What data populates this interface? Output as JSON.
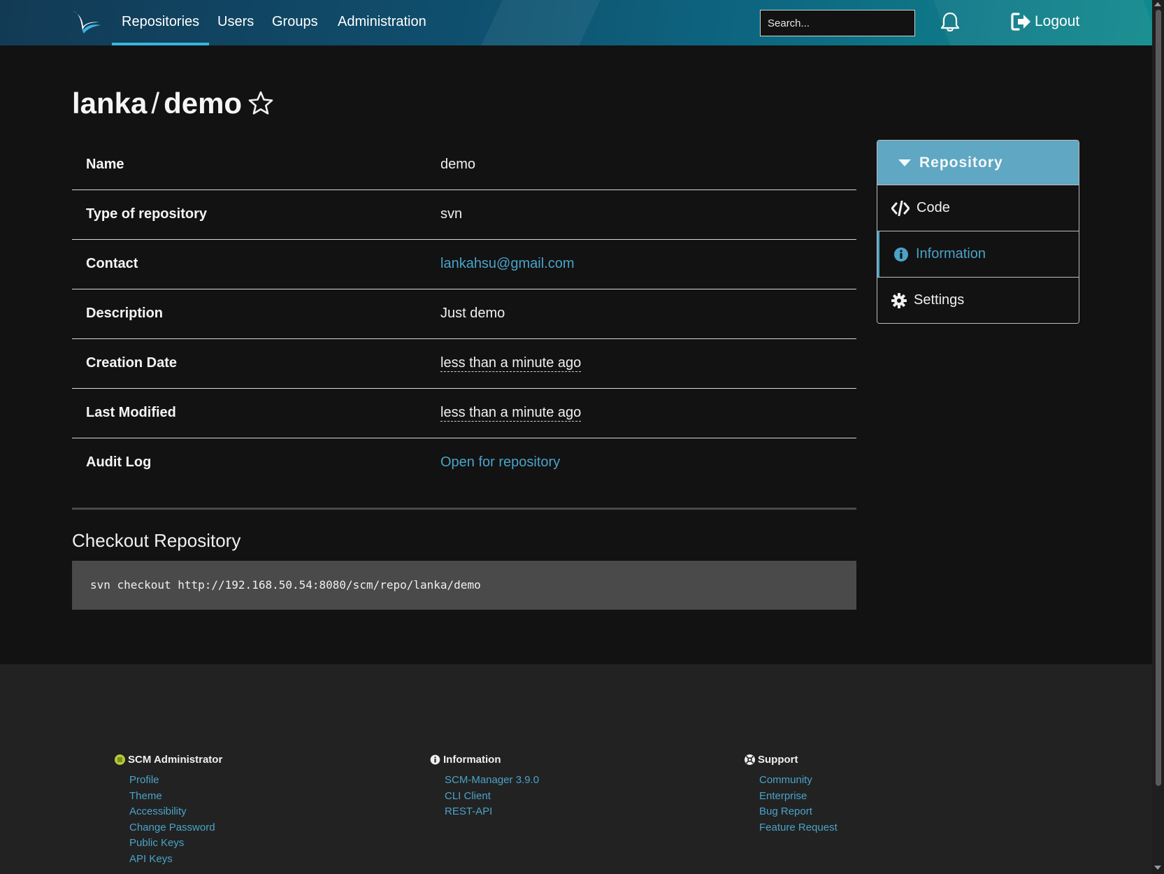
{
  "nav": {
    "items": [
      {
        "label": "Repositories"
      },
      {
        "label": "Users"
      },
      {
        "label": "Groups"
      },
      {
        "label": "Administration"
      }
    ],
    "active_index": 0,
    "search_placeholder": "Search...",
    "logout_label": "Logout"
  },
  "repo": {
    "namespace": "lanka",
    "separator": "/",
    "name": "demo"
  },
  "info": {
    "rows": [
      {
        "label": "Name",
        "value": "demo"
      },
      {
        "label": "Type of repository",
        "value": "svn"
      },
      {
        "label": "Contact",
        "value": "lankahsu@gmail.com"
      },
      {
        "label": "Description",
        "value": "Just demo"
      },
      {
        "label": "Creation Date",
        "value": "less than a minute ago"
      },
      {
        "label": "Last Modified",
        "value": "less than a minute ago"
      },
      {
        "label": "Audit Log",
        "value": "Open for repository"
      }
    ]
  },
  "checkout": {
    "title": "Checkout Repository",
    "command": "svn checkout http://192.168.50.54:8080/scm/repo/lanka/demo"
  },
  "menu": {
    "header": "Repository",
    "items": [
      {
        "label": "Code",
        "icon": "code-icon"
      },
      {
        "label": "Information",
        "icon": "info-circle-icon"
      },
      {
        "label": "Settings",
        "icon": "gear-icon"
      }
    ],
    "active_index": 1
  },
  "footer": {
    "user": {
      "title": "SCM Administrator",
      "links": [
        "Profile",
        "Theme",
        "Accessibility",
        "Change Password",
        "Public Keys",
        "API Keys"
      ]
    },
    "information": {
      "title": "Information",
      "links": [
        "SCM-Manager 3.9.0",
        "CLI Client",
        "REST-API"
      ]
    },
    "support": {
      "title": "Support",
      "links": [
        "Community",
        "Enterprise",
        "Bug Report",
        "Feature Request"
      ]
    }
  },
  "colors": {
    "accent": "#4aa3c8",
    "menu_header": "#5fa7c2",
    "background": "#121212",
    "footer": "#222222"
  }
}
